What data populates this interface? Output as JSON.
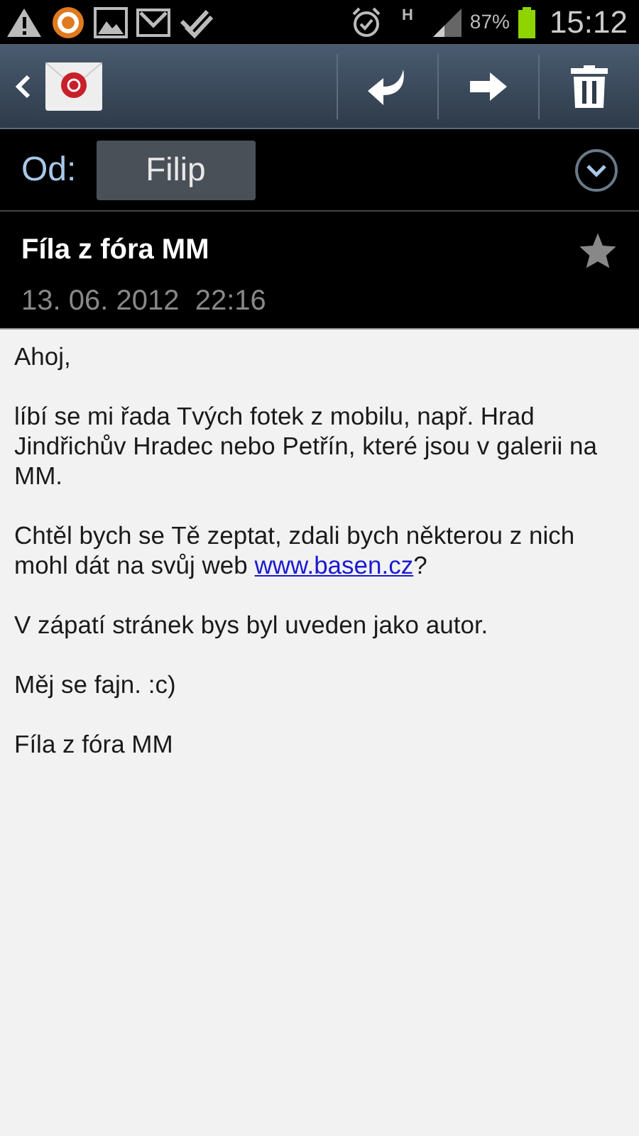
{
  "status_bar": {
    "battery": "87%",
    "time": "15:12",
    "network": "H"
  },
  "from": {
    "label": "Od:",
    "sender": "Filip",
    "expanded": false
  },
  "message": {
    "subject": "Fíla z fóra MM",
    "date": "13. 06. 2012  22:16",
    "starred": false
  },
  "body": [
    {
      "kind": "text",
      "text": "Ahoj,"
    },
    {
      "kind": "text",
      "text": "líbí se mi řada Tvých fotek z mobilu, např. Hrad Jindřichův Hradec nebo Petřín, které jsou v galerii na MM."
    },
    {
      "kind": "link",
      "before": "Chtěl bych se Tě zeptat, zdali bych některou z nich mohl dát na svůj web ",
      "link": "www.basen.cz",
      "after": "?"
    },
    {
      "kind": "text",
      "text": "V zápatí stránek bys byl uveden jako autor."
    },
    {
      "kind": "text",
      "text": "Měj se fajn. :c)"
    },
    {
      "kind": "text",
      "text": "Fíla z fóra MM"
    }
  ]
}
